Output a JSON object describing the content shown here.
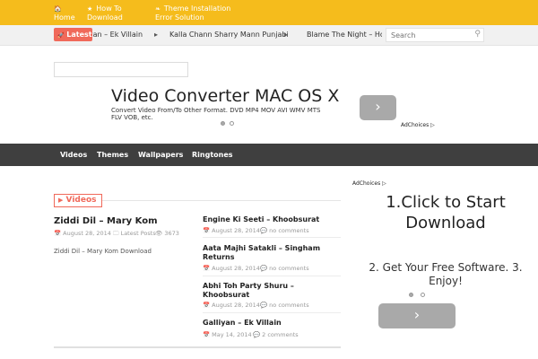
{
  "topnav": {
    "items": [
      {
        "icon": "home-icon",
        "glyph": "🏠",
        "label": "Home"
      },
      {
        "icon": "star-icon",
        "glyph": "★",
        "label": "How To Download"
      },
      {
        "icon": "leaf-icon",
        "glyph": "❧",
        "label": "Theme Installation Error Solution"
      }
    ]
  },
  "ticker": {
    "badge": "Latest",
    "badge_glyph": "🚀",
    "items": [
      "Ghalliyan – Ek Villain",
      "Kalla Chann Sharry Mann Punjabi",
      "Blame The Night – Holiday"
    ],
    "separator": "▸"
  },
  "search": {
    "placeholder": "Search",
    "icon_glyph": "⚲"
  },
  "ad_banner": {
    "title": "Video Converter MAC OS X",
    "description": "Convert Video From/To Other Format. DVD MP4 MOV AVI WMV MTS FLV VOB, etc.",
    "button_glyph": "›",
    "adchoices": "AdChoices ▷"
  },
  "mainnav": {
    "items": [
      "Videos",
      "Themes",
      "Wallpapers",
      "Ringtones"
    ]
  },
  "videos_section": {
    "title": "Videos",
    "icon_glyph": "▶",
    "featured": {
      "title": "Ziddi Dil – Mary Kom",
      "date": "📅 August 28, 2014",
      "category": "🗀 Latest Posts",
      "views": "👁 3673",
      "excerpt": "Ziddi Dil – Mary Kom   Download"
    },
    "posts": [
      {
        "title": "Engine Ki Seeti – Khoobsurat",
        "date": "📅 August 28, 2014",
        "comments": "💬 no comments"
      },
      {
        "title": "Aata Majhi Satakli – Singham Returns",
        "date": "📅 August 28, 2014",
        "comments": "💬 no comments"
      },
      {
        "title": "Abhi Toh Party Shuru – Khoobsurat",
        "date": "📅 August 28, 2014",
        "comments": "💬 no comments"
      },
      {
        "title": "Galliyan – Ek Villain",
        "date": "📅 May 14, 2014",
        "comments": "💬 2 comments"
      }
    ]
  },
  "side_ad": {
    "adchoices": "AdChoices ▷",
    "headline": "1.Click to Start Download",
    "subtext": "2. Get Your Free Software. 3. Enjoy!",
    "button_glyph": "›"
  },
  "colors": {
    "topbar": "#f5bc1c",
    "accent": "#f0695a",
    "nav": "#3f3f3f"
  }
}
